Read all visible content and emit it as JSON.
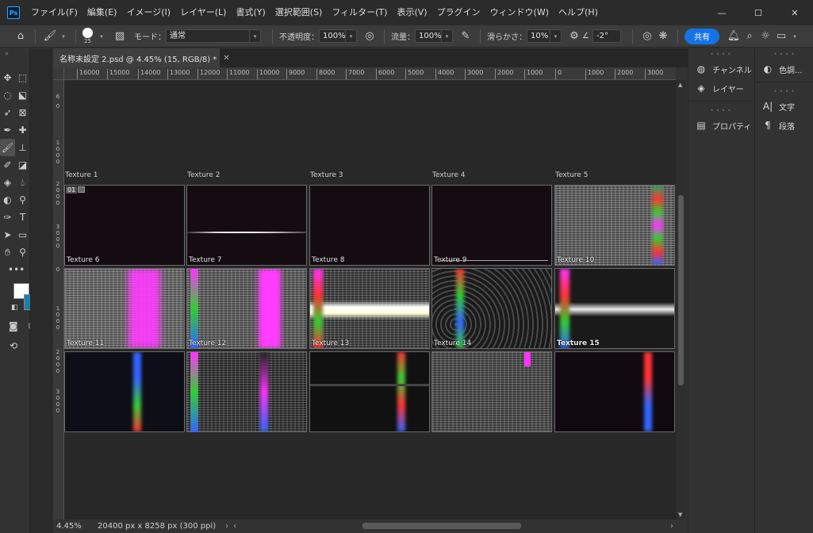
{
  "menubar": {
    "logo": "Ps",
    "items": [
      "ファイル(F)",
      "編集(E)",
      "イメージ(I)",
      "レイヤー(L)",
      "書式(Y)",
      "選択範囲(S)",
      "フィルター(T)",
      "表示(V)",
      "プラグイン",
      "ウィンドウ(W)",
      "ヘルプ(H)"
    ]
  },
  "options": {
    "brush_size": "25",
    "mode_label": "モード：",
    "mode_value": "通常",
    "opacity_label": "不透明度：",
    "opacity_value": "100%",
    "flow_label": "流量：",
    "flow_value": "100%",
    "smoothing_label": "滑らかさ：",
    "smoothing_value": "10%",
    "angle_value": "-2°",
    "share_label": "共有"
  },
  "document": {
    "tab_title": "名称未設定 2.psd @ 4.45% (15, RGB/8) *"
  },
  "ruler_h": [
    "16000",
    "15000",
    "14000",
    "13000",
    "12000",
    "11000",
    "10000",
    "9000",
    "8000",
    "7000",
    "6000",
    "5000",
    "4000",
    "3000",
    "2000",
    "1000",
    "0",
    "1000",
    "2000",
    "3000"
  ],
  "ruler_v": [
    "6",
    "0",
    "1 0 0 0",
    "2 0 0 0",
    "3 0 0 0",
    "0",
    "1 0 0 0",
    "2 0 0 0",
    "3 0 0 0"
  ],
  "captions_top": [
    "Texture 1",
    "Texture 2",
    "Texture 3",
    "Texture 4",
    "Texture 5"
  ],
  "badge": "01",
  "thumbs_row1": [
    "Texture 6",
    "Texture 7",
    "Texture 8",
    "Texture 9",
    "Texture 10"
  ],
  "thumbs_row2": [
    "Texture 11",
    "Texture 12",
    "Texture 13",
    "Texture 14",
    "Texture 15"
  ],
  "status": {
    "zoom": "4.45%",
    "doc_size": "20400 px x 8258 px (300 ppi)"
  },
  "panels": {
    "channels": "チャンネル",
    "layers": "レイヤー",
    "properties": "プロパティ",
    "color": "色調...",
    "character": "文字",
    "paragraph": "段落"
  }
}
